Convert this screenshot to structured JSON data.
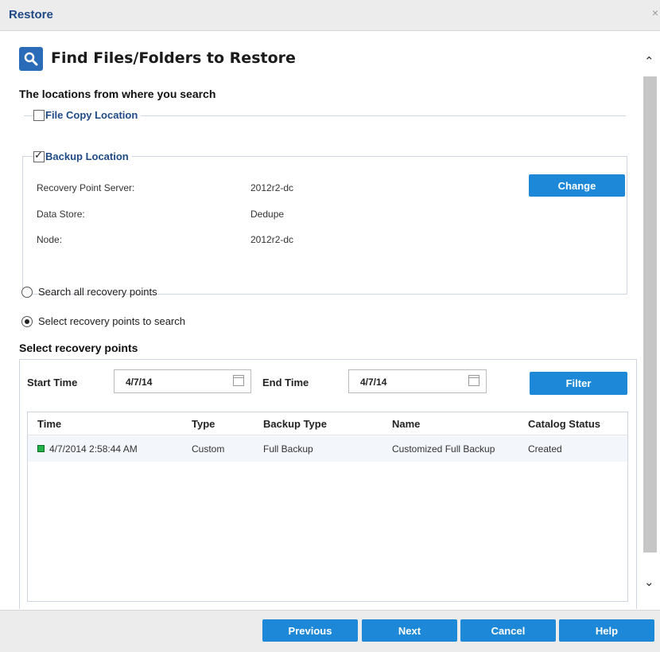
{
  "window": {
    "title": "Restore",
    "close_glyph": "×"
  },
  "header": {
    "title": "Find Files/Folders to Restore",
    "icon": "search-icon"
  },
  "locations": {
    "title": "The locations from where you search",
    "file_copy": {
      "label": "File Copy Location",
      "checked": false
    },
    "backup": {
      "label": "Backup Location",
      "checked": true,
      "fields": [
        {
          "label": "Recovery Point Server:",
          "value": "2012r2-dc"
        },
        {
          "label": "Data Store:",
          "value": "Dedupe"
        },
        {
          "label": "Node:",
          "value": "2012r2-dc"
        }
      ],
      "change_label": "Change"
    }
  },
  "search_options": [
    {
      "label": "Search all recovery points",
      "selected": false
    },
    {
      "label": "Select recovery points to search",
      "selected": true
    }
  ],
  "recovery_points": {
    "title": "Select recovery points",
    "start_time_label": "Start Time",
    "start_time_value": "4/7/14",
    "end_time_label": "End Time",
    "end_time_value": "4/7/14",
    "filter_label": "Filter",
    "columns": [
      "Time",
      "Type",
      "Backup Type",
      "Name",
      "Catalog Status"
    ],
    "rows": [
      {
        "time": "4/7/2014 2:58:44 AM",
        "type": "Custom",
        "backup_type": "Full Backup",
        "name": "Customized Full Backup",
        "catalog_status": "Created",
        "status_color": "#21b24a"
      }
    ]
  },
  "footer": {
    "previous": "Previous",
    "next": "Next",
    "cancel": "Cancel",
    "help": "Help"
  },
  "colors": {
    "accent": "#1e88d8",
    "title_blue": "#1f4a86"
  }
}
